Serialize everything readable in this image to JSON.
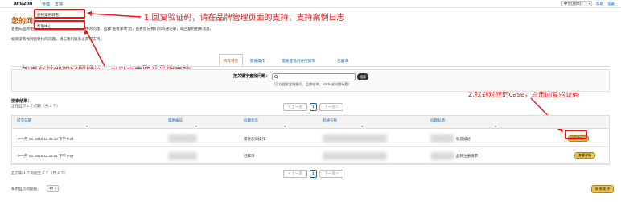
{
  "topbar": {
    "logo": "amazon",
    "nav": [
      "管理",
      "支持"
    ],
    "language": "中文(简体)",
    "links": [
      "帮助",
      "设置"
    ]
  },
  "dropdown": {
    "items": [
      "支持案例日志",
      "帮助中心"
    ]
  },
  "page": {
    "title": "您的问题日志",
    "desc1": "查看与品牌相关的所有问题的状态，跟踪进行中的问题，选择“查看详情”后，查看您与我们的沟通记录，或回复的相关消息。",
    "desc2": "如果没有找到您要找的问题，请与我们联系以获得支持。"
  },
  "annotations": {
    "a1": "1.回复验证码，请在品牌管理页面的支持，支持案例日志",
    "a2": "如果有其他的问题疑问，可以点击联系品牌支持",
    "a3": "2.找到对应的case，点击回复验证码"
  },
  "tabs": [
    "所有日志",
    "需要操作",
    "需要亚马逊进行操作",
    "已解决"
  ],
  "search": {
    "label": "按关键字查找问题：",
    "button": "搜索",
    "hint": "（可以搜索案例编号、品牌名称、ASIN 或问题标题）"
  },
  "results": {
    "label": "搜索结果：",
    "count_top": "正在显示 1 个问题（共 2 个）",
    "count_bottom": "显示第 1 个问题至 2 个（共 2 个）"
  },
  "pager_top": {
    "prev": "< 上一页",
    "page": "1",
    "next": "下一页 >"
  },
  "pager_bottom": {
    "prev": "< 上一页",
    "page": "1",
    "next": "下一页 >"
  },
  "table": {
    "headers": [
      "提交日期",
      "案例编号",
      "问题状态",
      "品牌名称",
      "问题标题"
    ],
    "rows": [
      {
        "date": "十一月 18, 2019 11:45:13 下午 PST",
        "status": "需要您的操作",
        "title_suffix": "标签描述",
        "action": "回复验证码"
      },
      {
        "date": "十一月 18, 2019 11:33:01 下午 PST",
        "status": "已解决",
        "title_suffix": "品牌注册请求",
        "action": "查看详情"
      }
    ]
  },
  "footer": {
    "per_page_label": "每页显示问题数：",
    "per_page_value": "10",
    "help_button": "联系支持"
  },
  "colors": {
    "accent": "#c45500",
    "link": "#0066c0",
    "annotation": "#ee1111",
    "button": "#f0c14b"
  }
}
